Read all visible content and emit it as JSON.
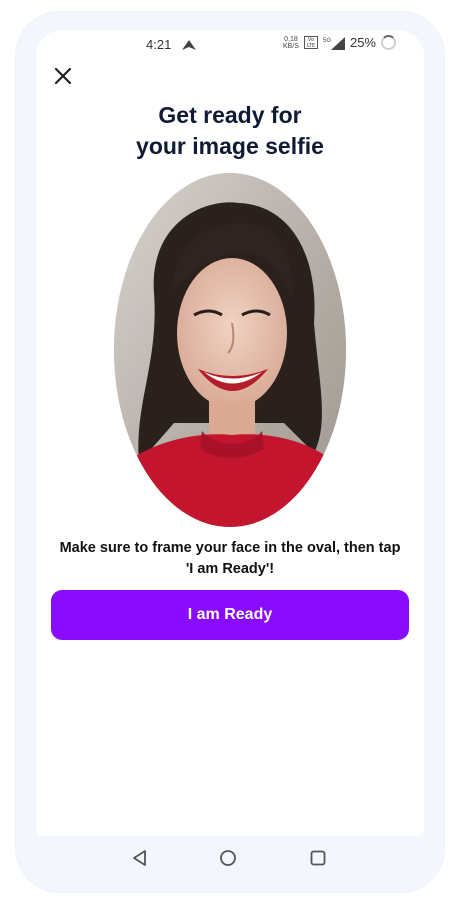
{
  "status_bar": {
    "time": "4:21",
    "speed_value": "0.18",
    "speed_unit": "KB/S",
    "network": "5G",
    "battery": "25%"
  },
  "header": {
    "title": "Get ready for\nyour image selfie"
  },
  "main": {
    "instructions": "Make sure to frame your face in the oval, then tap  'I am Ready'!",
    "ready_button_label": "I am Ready"
  },
  "colors": {
    "accent": "#8a0cff",
    "title": "#111a33"
  },
  "icons": {
    "close": "close-icon",
    "back": "back-icon",
    "home": "home-icon",
    "recents": "recents-icon"
  }
}
